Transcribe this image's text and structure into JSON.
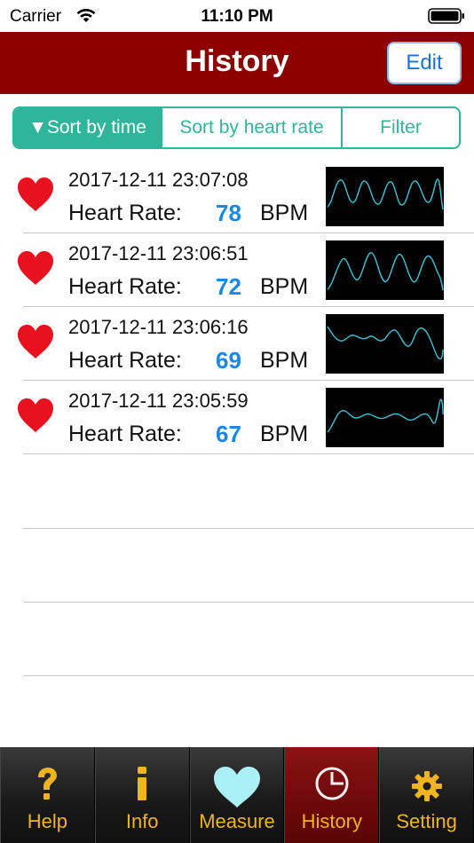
{
  "status_bar": {
    "carrier": "Carrier",
    "time": "11:10 PM"
  },
  "nav": {
    "title": "History",
    "edit_label": "Edit"
  },
  "sort": {
    "segments": [
      "▼Sort by time",
      "Sort by heart rate",
      "Filter"
    ],
    "selected": 0
  },
  "list": {
    "rows": [
      {
        "date": "2017-12-11 23:07:08",
        "label": "Heart Rate:",
        "bpm": "78",
        "unit": "BPM"
      },
      {
        "date": "2017-12-11 23:06:51",
        "label": "Heart Rate:",
        "bpm": "72",
        "unit": "BPM"
      },
      {
        "date": "2017-12-11 23:06:16",
        "label": "Heart Rate:",
        "bpm": "69",
        "unit": "BPM"
      },
      {
        "date": "2017-12-11 23:05:59",
        "label": "Heart Rate:",
        "bpm": "67",
        "unit": "BPM"
      }
    ]
  },
  "tabs": [
    {
      "label": "Help",
      "icon": "question-icon"
    },
    {
      "label": "Info",
      "icon": "info-icon"
    },
    {
      "label": "Measure",
      "icon": "heart-icon"
    },
    {
      "label": "History",
      "icon": "history-icon"
    },
    {
      "label": "Setting",
      "icon": "gear-icon"
    }
  ],
  "colors": {
    "nav_background": "#8c0000",
    "accent_teal": "#2eb59a",
    "bpm_blue": "#1a88e8",
    "heart_red": "#e8121e",
    "tab_label": "#f0b41e",
    "wave_line": "#3fc2d6"
  }
}
